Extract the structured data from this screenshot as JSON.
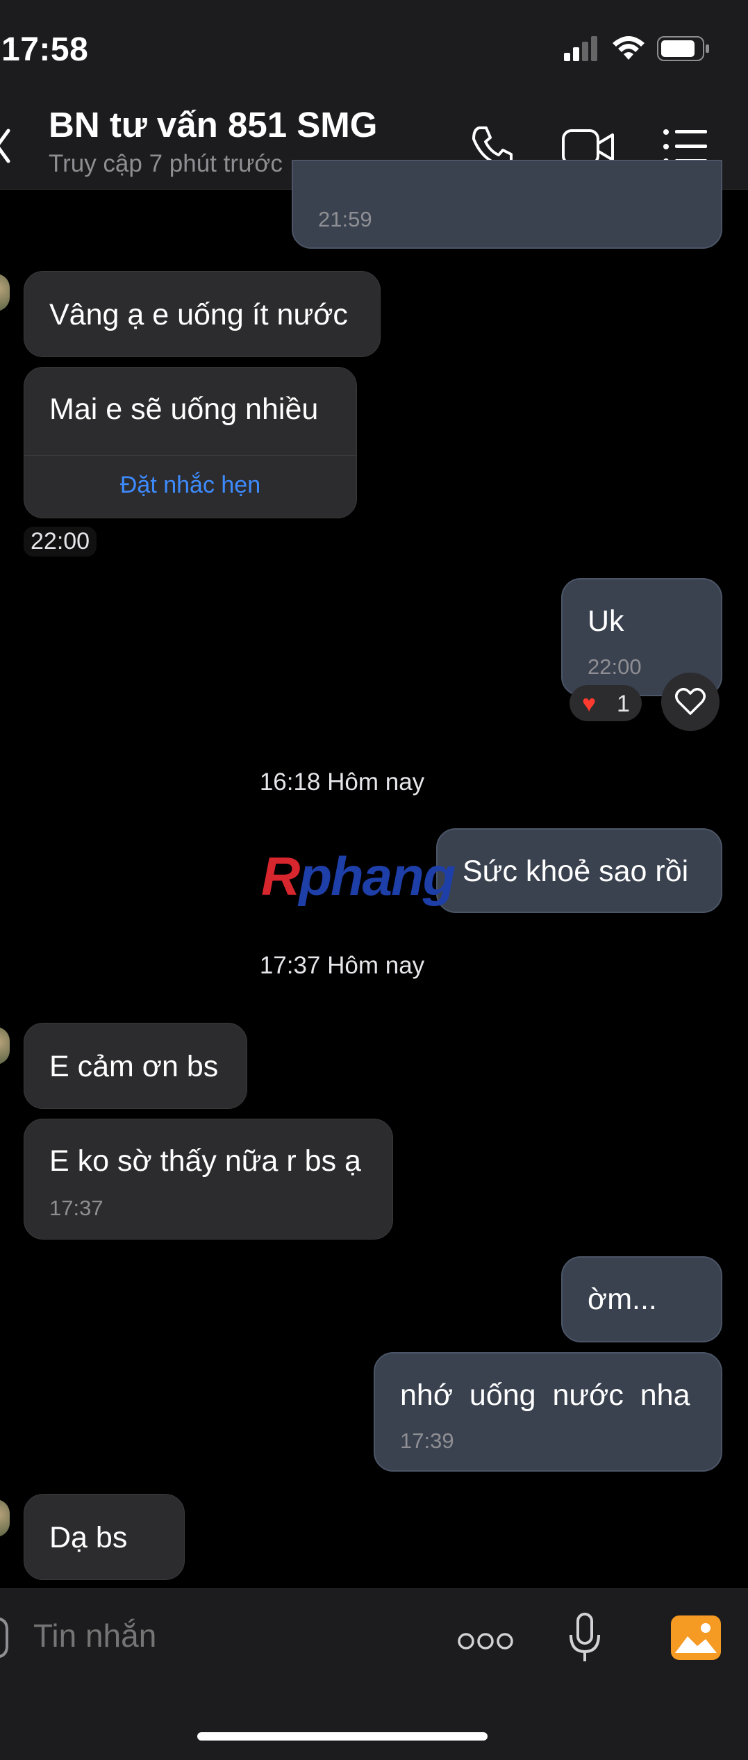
{
  "status": {
    "time": "17:58"
  },
  "header": {
    "title": "BN tư vấn 851 SMG",
    "subtitle": "Truy cập 7 phút trước",
    "icons": [
      "back-chevron-icon",
      "phone-icon",
      "video-icon",
      "menu-list-icon"
    ]
  },
  "messages": {
    "m0_time": "21:59",
    "m1_text": "Vâng ạ e uống ít nước",
    "m2_text": "Mai e sẽ uống nhiều",
    "m2_action": "Đặt nhắc hẹn",
    "m2_time": "22:00",
    "m3_text": "Uk",
    "m3_time": "22:00",
    "m3_reaction_count": "1",
    "day1": "16:18 Hôm nay",
    "m4_text": "Sức khoẻ sao rồi",
    "day2": "17:37 Hôm nay",
    "m5_text": "E cảm ơn bs",
    "m6_text": "E ko sờ thấy nữa r bs ạ",
    "m6_time": "17:37",
    "m7_text": "ờm...",
    "m8_text": "nhớ  uống  nước  nha",
    "m8_time": "17:39",
    "m9_text": "Dạ bs"
  },
  "watermark": {
    "part1": "R",
    "part2": "phang"
  },
  "composer": {
    "placeholder": "Tin nhắn",
    "icons": [
      "more-icon",
      "microphone-icon",
      "image-icon"
    ]
  },
  "colors": {
    "accent": "#3d8bff",
    "outgoing_bubble": "#3a4250",
    "incoming_bubble": "#2c2c2e",
    "image_icon": "#f59a23"
  }
}
